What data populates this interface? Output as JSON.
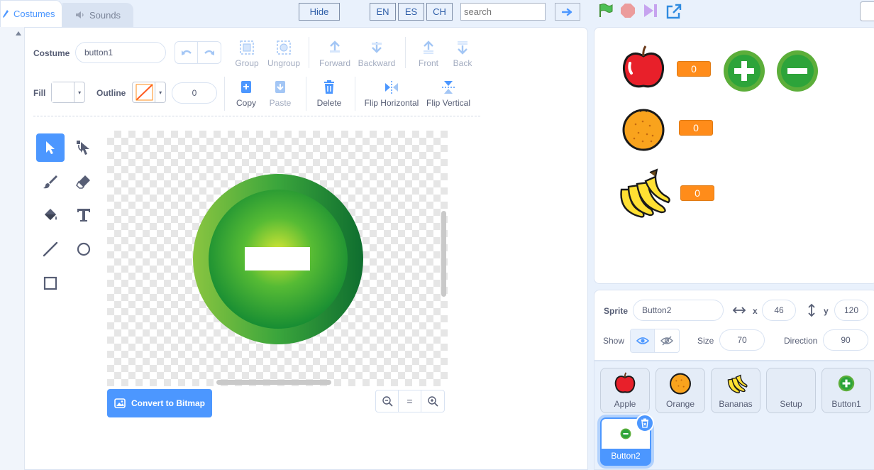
{
  "tabs": {
    "costumes": "Costumes",
    "sounds": "Sounds"
  },
  "top_bar": {
    "hide": "Hide",
    "lang_en": "EN",
    "lang_es": "ES",
    "lang_ch": "CH",
    "search_placeholder": "search"
  },
  "editor": {
    "costume_label": "Costume",
    "costume_name": "button1",
    "group": "Group",
    "ungroup": "Ungroup",
    "forward": "Forward",
    "backward": "Backward",
    "front": "Front",
    "back": "Back",
    "fill_label": "Fill",
    "outline_label": "Outline",
    "outline_width": "0",
    "copy": "Copy",
    "paste": "Paste",
    "delete": "Delete",
    "flip_horizontal": "Flip Horizontal",
    "flip_vertical": "Flip Vertical",
    "convert_bitmap": "Convert to Bitmap",
    "zoom_reset": "="
  },
  "stage": {
    "scores": [
      "0",
      "0",
      "0"
    ]
  },
  "sprite_info": {
    "sprite_label": "Sprite",
    "sprite_name": "Button2",
    "x_label": "x",
    "x": "46",
    "y_label": "y",
    "y": "120",
    "show_label": "Show",
    "size_label": "Size",
    "size": "70",
    "direction_label": "Direction",
    "direction": "90"
  },
  "sprites": [
    {
      "name": "Apple",
      "icon": "apple-icon"
    },
    {
      "name": "Orange",
      "icon": "orange-icon"
    },
    {
      "name": "Bananas",
      "icon": "banana-icon"
    },
    {
      "name": "Setup",
      "icon": ""
    },
    {
      "name": "Button1",
      "icon": "plus-button-icon"
    },
    {
      "name": "Button2",
      "icon": "minus-button-icon",
      "selected": true
    }
  ],
  "colors": {
    "accent": "#4c97ff",
    "score_orange": "#ff8c1a",
    "button_green": "#2da43a"
  }
}
